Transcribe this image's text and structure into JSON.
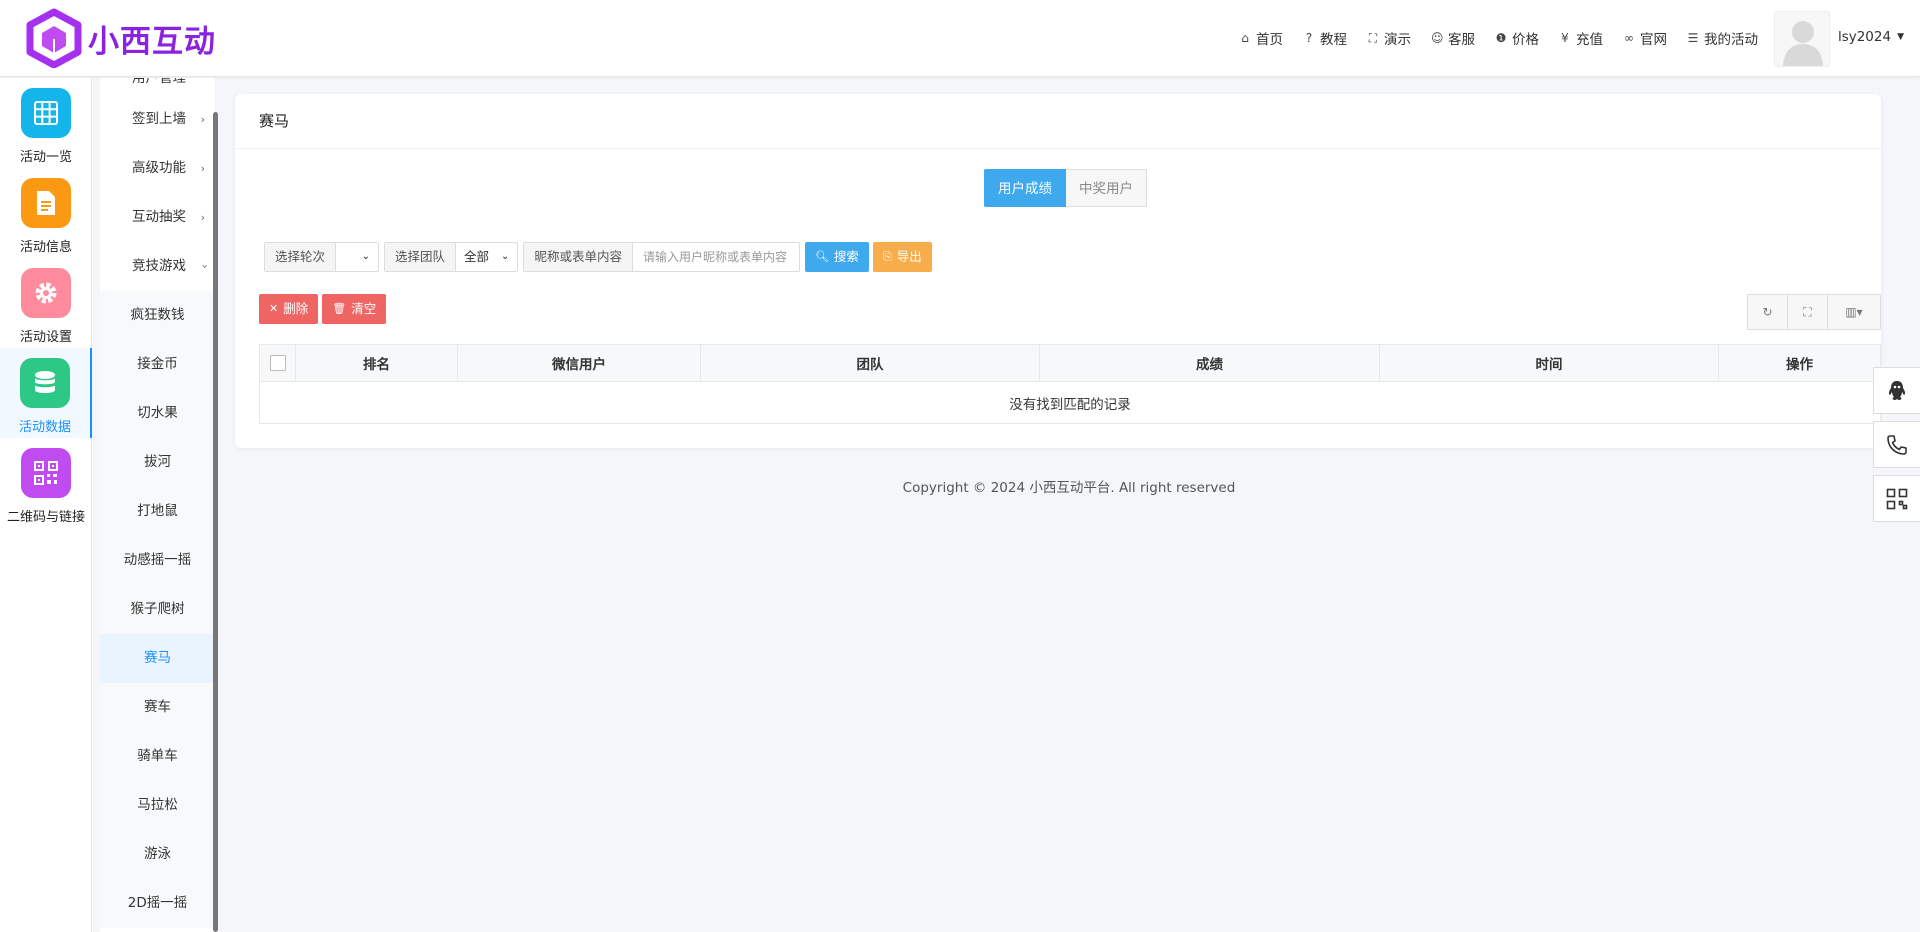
{
  "brand": {
    "name": "小西互动",
    "color": "#8b22e0"
  },
  "topnav": [
    {
      "icon": "home-icon",
      "glyph": "⌂",
      "label": "首页"
    },
    {
      "icon": "help-icon",
      "glyph": "?",
      "label": "教程"
    },
    {
      "icon": "expand-icon",
      "glyph": "⛶",
      "label": "演示"
    },
    {
      "icon": "smile-icon",
      "glyph": "☺",
      "label": "客服"
    },
    {
      "icon": "info-icon",
      "glyph": "❶",
      "label": "价格"
    },
    {
      "icon": "yen-icon",
      "glyph": "¥",
      "label": "充值"
    },
    {
      "icon": "link-icon",
      "glyph": "∞",
      "label": "官网"
    },
    {
      "icon": "list-icon",
      "glyph": "☰",
      "label": "我的活动"
    }
  ],
  "user": {
    "name": "lsy2024"
  },
  "rail": [
    {
      "label": "活动一览",
      "color": "#13b5ea",
      "icon": "grid-icon"
    },
    {
      "label": "活动信息",
      "color": "#fb9a12",
      "icon": "document-icon"
    },
    {
      "label": "活动设置",
      "color": "#ff8b9c",
      "icon": "gear-icon"
    },
    {
      "label": "活动数据",
      "color": "#2ec886",
      "icon": "database-icon"
    },
    {
      "label": "二维码与链接",
      "color": "#c04bf0",
      "icon": "qrcode-icon"
    }
  ],
  "submenu": {
    "partial": "用户管理",
    "groups": [
      {
        "label": "签到上墙",
        "arrow": "›"
      },
      {
        "label": "高级功能",
        "arrow": "›"
      },
      {
        "label": "互动抽奖",
        "arrow": "›"
      },
      {
        "label": "竞技游戏",
        "arrow": "›"
      }
    ],
    "children": [
      "疯狂数钱",
      "接金币",
      "切水果",
      "拔河",
      "打地鼠",
      "动感摇一摇",
      "猴子爬树",
      "赛马",
      "赛车",
      "骑单车",
      "马拉松",
      "游泳",
      "2D摇一摇"
    ],
    "active": "赛马"
  },
  "panel": {
    "title": "赛马",
    "tabs": {
      "active": "用户成绩",
      "inactive": "中奖用户"
    },
    "filters": {
      "round_label": "选择轮次",
      "round_value": "",
      "team_label": "选择团队",
      "team_value": "全部",
      "search_label": "昵称或表单内容",
      "search_placeholder": "请输入用户昵称或表单内容",
      "search_btn": "搜索",
      "export_btn": "导出"
    },
    "actions": {
      "delete": "删除",
      "clear": "清空"
    },
    "table": {
      "columns": [
        "排名",
        "微信用户",
        "团队",
        "成绩",
        "时间",
        "操作"
      ],
      "empty": "没有找到匹配的记录"
    }
  },
  "copyright": "Copyright © 2024 小西互动平台. All right reserved"
}
